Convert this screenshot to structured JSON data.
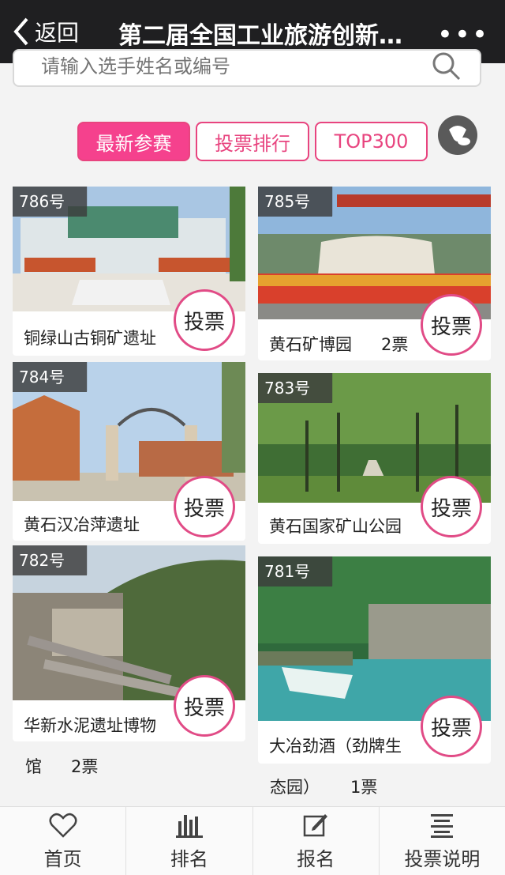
{
  "header": {
    "back_label": "返回",
    "title": "第二届全国工业旅游创新…",
    "more_label": "•••"
  },
  "search": {
    "placeholder": "请输入选手姓名或编号"
  },
  "tabs": [
    {
      "label": "最新参赛",
      "active": true
    },
    {
      "label": "投票排行",
      "active": false
    },
    {
      "label": "TOP300",
      "active": false
    }
  ],
  "vote_label": "投票",
  "cards": [
    {
      "num": "786号",
      "name": "铜绿山古铜矿遗址",
      "votes": ""
    },
    {
      "num": "785号",
      "name": "黄石矿博园",
      "votes": "2票"
    },
    {
      "num": "784号",
      "name": "黄石汉冶萍遗址",
      "votes": ""
    },
    {
      "num": "783号",
      "name": "黄石国家矿山公园",
      "votes": ""
    },
    {
      "num": "782号",
      "name": "华新水泥遗址博物",
      "name2": "馆",
      "votes": "2票"
    },
    {
      "num": "781号",
      "name": "大冶劲酒（劲牌生",
      "name2": "态园）",
      "votes": "1票"
    }
  ],
  "bottom_nav": [
    {
      "label": "首页",
      "icon": "heart-icon"
    },
    {
      "label": "排名",
      "icon": "bar-chart-icon"
    },
    {
      "label": "报名",
      "icon": "edit-icon"
    },
    {
      "label": "投票说明",
      "icon": "document-icon"
    }
  ],
  "colors": {
    "accent": "#f5418d",
    "border": "#e8447f",
    "header_bg": "#1f1f21"
  }
}
